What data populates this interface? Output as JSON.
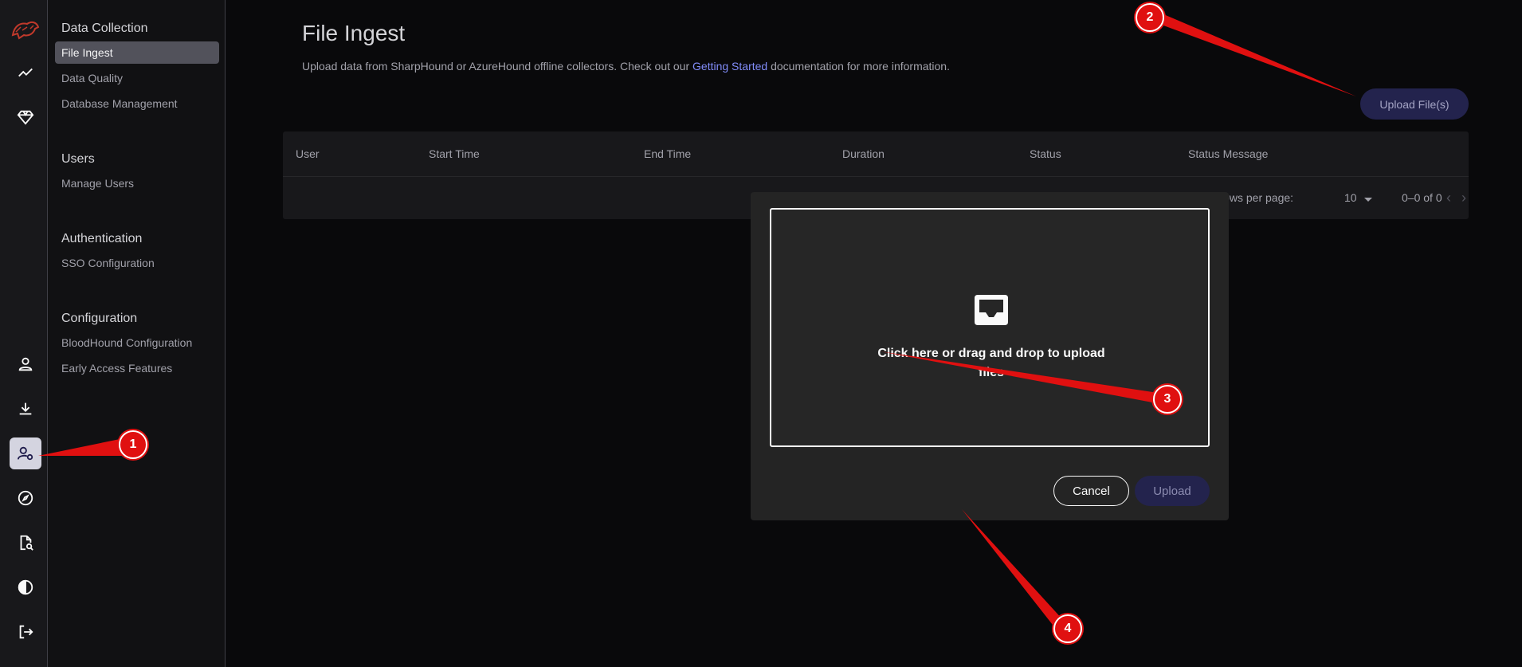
{
  "rail": {
    "icons": [
      "bloodhound-logo-icon",
      "trend-chart-icon",
      "gem-icon",
      "person-icon",
      "download-icon",
      "user-gear-icon",
      "compass-icon",
      "document-search-icon",
      "contrast-icon",
      "logout-icon"
    ],
    "active": "user-gear-icon"
  },
  "subnav": {
    "sections": [
      {
        "title": "Data Collection",
        "items": [
          "File Ingest",
          "Data Quality",
          "Database Management"
        ]
      },
      {
        "title": "Users",
        "items": [
          "Manage Users"
        ]
      },
      {
        "title": "Authentication",
        "items": [
          "SSO Configuration"
        ]
      },
      {
        "title": "Configuration",
        "items": [
          "BloodHound Configuration",
          "Early Access Features"
        ]
      }
    ],
    "active_item": "File Ingest"
  },
  "page": {
    "title": "File Ingest",
    "description_before": "Upload data from SharpHound or AzureHound offline collectors. Check out our ",
    "description_link": "Getting Started",
    "description_after": " documentation for more information.",
    "upload_files_button": "Upload File(s)"
  },
  "table": {
    "columns": [
      "User",
      "Start Time",
      "End Time",
      "Duration",
      "Status",
      "Status Message"
    ],
    "rows": [],
    "pagination": {
      "rows_per_page_label": "Rows per page:",
      "rows_per_page": "10",
      "range": "0–0 of 0"
    }
  },
  "dialog": {
    "dropzone_text": "Click here or drag and drop to upload files",
    "cancel_label": "Cancel",
    "upload_label": "Upload"
  },
  "annotations": {
    "markers": [
      "1",
      "2",
      "3",
      "4"
    ],
    "color": "#e01010"
  },
  "colors": {
    "background": "#09090b",
    "accent_button": "#23234d",
    "link": "#818cf8"
  }
}
